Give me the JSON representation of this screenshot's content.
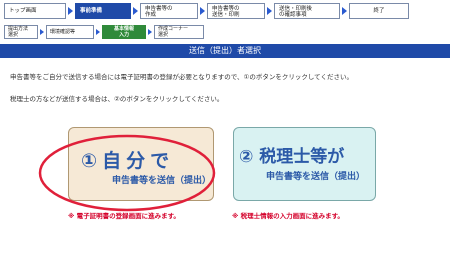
{
  "progress": {
    "main_steps": [
      {
        "label": "トップ画面"
      },
      {
        "label": "事前準備"
      },
      {
        "label": "申告書等の\n作成"
      },
      {
        "label": "申告書等の\n送信・印刷"
      },
      {
        "label": "送信・印刷後\nの確認事項"
      },
      {
        "label": "終了"
      }
    ],
    "sub_steps": [
      {
        "label": "提出方法\n選択"
      },
      {
        "label": "環境確認等"
      },
      {
        "label": "基本情報\n入力"
      },
      {
        "label": "作成コーナー\n選択"
      }
    ]
  },
  "page": {
    "title": "送信（提出）者選択",
    "instruction_1": "申告書等をご自分で送信する場合には電子証明書の登録が必要となりますので、①のボタンをクリックしてください。",
    "instruction_2": "税理士の方などが送信する場合は、②のボタンをクリックしてください。"
  },
  "options": {
    "self": {
      "main": "①自分で",
      "sub": "申告書等を送信（提出）",
      "note": "※ 電子証明書の登録画面に進みます。"
    },
    "tax_accountant": {
      "main": "② 税理士等が",
      "sub": "申告書等を送信（提出）",
      "note": "※ 税理士情報の入力画面に進みます。"
    }
  },
  "colors": {
    "accent_blue": "#1f4aa8",
    "active_green": "#2f8a3a",
    "card1_bg": "#f6e9d6",
    "card2_bg": "#d9f2f2",
    "note_red": "#d4002a",
    "highlight_red": "#e0203a"
  }
}
